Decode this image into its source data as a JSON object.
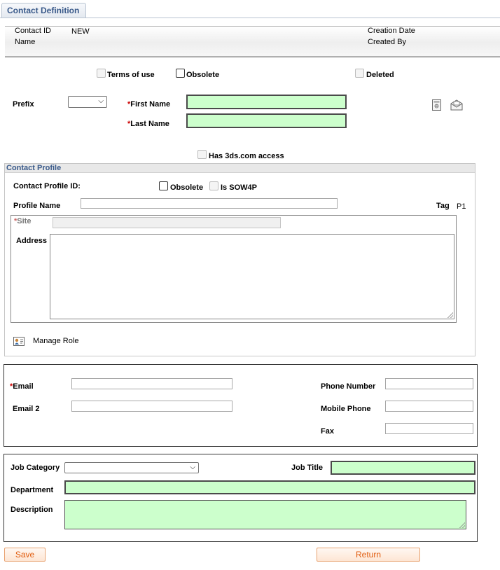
{
  "tab": {
    "label": "Contact Definition"
  },
  "header": {
    "contact_id_label": "Contact ID",
    "contact_id_value": "NEW",
    "name_label": "Name",
    "creation_date_label": "Creation Date",
    "created_by_label": "Created By"
  },
  "flags": {
    "terms_of_use": "Terms of use",
    "obsolete": "Obsolete",
    "deleted": "Deleted",
    "has_3ds_access": "Has 3ds.com access"
  },
  "name_fields": {
    "prefix_label": "Prefix",
    "prefix_value": "",
    "first_name_label": "First Name",
    "last_name_label": "Last Name",
    "required_marker": "*"
  },
  "icons": {
    "document_icon": "document-icon",
    "envelope_icon": "envelope-icon",
    "role_icon": "contact-card-icon"
  },
  "contact_profile": {
    "section_title": "Contact Profile",
    "profile_id_label": "Contact Profile ID:",
    "obsolete_label": "Obsolete",
    "is_sow4p_label": "Is SOW4P",
    "profile_name_label": "Profile Name",
    "tag_label": "Tag",
    "tag_value": "P1",
    "site_label": "Site",
    "address_label": "Address",
    "manage_role_label": "Manage Role"
  },
  "contact_info": {
    "email_label": "Email",
    "email2_label": "Email 2",
    "phone_label": "Phone Number",
    "mobile_label": "Mobile Phone",
    "fax_label": "Fax"
  },
  "job": {
    "category_label": "Job Category",
    "category_value": "",
    "title_label": "Job Title",
    "department_label": "Department",
    "description_label": "Description"
  },
  "buttons": {
    "save": "Save",
    "return": "Return"
  },
  "colors": {
    "required_field_bg": "#ccffcc",
    "button_text": "#e05a0c",
    "tab_text": "#3a5a8a"
  }
}
